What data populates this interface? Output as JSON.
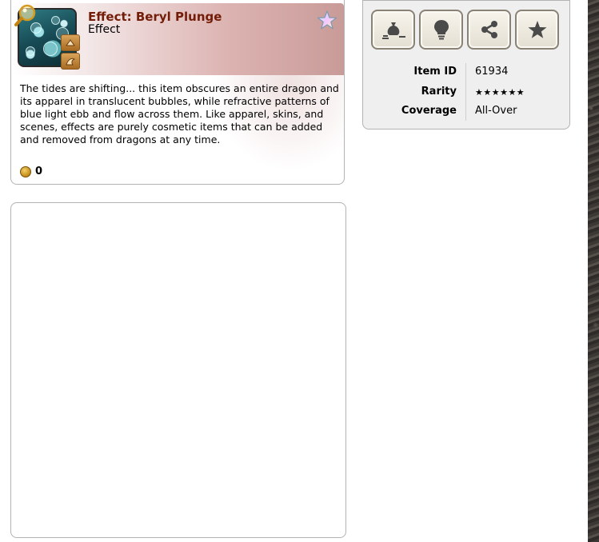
{
  "item": {
    "title": "Effect: Beryl Plunge",
    "type": "Effect",
    "description": "The tides are shifting... this item obscures an entire dragon and its apparel in translucent bubbles, while refractive patterns of blue light ebb and flow across them. Like apparel, skins, and scenes, effects are purely cosmetic items that can be added and removed from dragons at any time.",
    "price": "0"
  },
  "actions": {
    "buttons": [
      {
        "icon": "sell-bag-icon"
      },
      {
        "icon": "lightbulb-icon"
      },
      {
        "icon": "share-icon"
      },
      {
        "icon": "star-icon"
      }
    ]
  },
  "info": {
    "rows": [
      {
        "label": "Item ID",
        "value": "61934"
      },
      {
        "label": "Rarity",
        "value": "★★★★★★"
      },
      {
        "label": "Coverage",
        "value": "All-Over"
      }
    ]
  },
  "colors": {
    "title": "#731d08",
    "header_gradient_end": "#c89b98",
    "panel_bg": "#efefef"
  }
}
